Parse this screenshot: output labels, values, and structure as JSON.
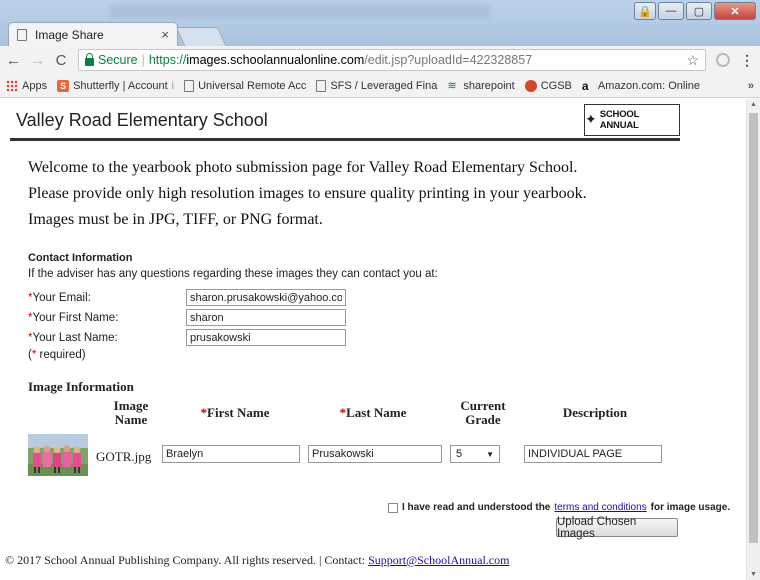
{
  "browser": {
    "tab_title": "Image Share",
    "tab_close": "×",
    "window_buttons": [
      "🔒",
      "—",
      "▢",
      "✕"
    ],
    "nav": {
      "back": "←",
      "forward": "→",
      "reload": "C"
    },
    "omnibox": {
      "secure_label": "Secure",
      "scheme": "https://",
      "host": "images.schoolannualonline.com",
      "path": "/edit.jsp?uploadId=422328857",
      "star": "☆"
    },
    "menu": "⋮",
    "bookmarks": [
      {
        "icon": "apps-icon",
        "label": "Apps",
        "dim": ""
      },
      {
        "icon": "shutterfly-icon",
        "label": "Shutterfly | Account",
        "dim": " i"
      },
      {
        "icon": "page-icon",
        "label": "Universal Remote Acc",
        "dim": ""
      },
      {
        "icon": "page-icon",
        "label": "SFS / Leveraged Fina",
        "dim": ""
      },
      {
        "icon": "sharepoint-icon",
        "label": "sharepoint",
        "dim": ""
      },
      {
        "icon": "cgsb-icon",
        "label": "CGSB",
        "dim": ""
      },
      {
        "icon": "amazon-icon",
        "label": "Amazon.com: Online",
        "dim": ""
      }
    ],
    "bookmarks_more": "»",
    "sharepoint_glyph": "≋",
    "shutterfly_glyph": "S",
    "amazon_glyph": "a"
  },
  "page": {
    "school_name": "Valley Road Elementary School",
    "logo_text": "SCHOOL ANNUAL",
    "logo_mark": "✦",
    "intro_lines": [
      "Welcome to the yearbook photo submission page for Valley Road Elementary School.",
      "Please provide only high resolution images to ensure quality printing in your yearbook.",
      "Images must be in JPG, TIFF, or PNG format."
    ],
    "contact": {
      "title": "Contact Information",
      "note": "If the adviser has any questions regarding these images they can contact you at:",
      "asterisk": "*",
      "fields": [
        {
          "label": "Your Email:",
          "value": "sharon.prusakowski@yahoo.com"
        },
        {
          "label": "Your First Name:",
          "value": "sharon"
        },
        {
          "label": "Your Last Name:",
          "value": "prusakowski"
        }
      ],
      "required_note": "(* required)"
    },
    "image_info": {
      "title": "Image Information",
      "headers": {
        "image_name": [
          "Image",
          "Name"
        ],
        "first_name": "First Name",
        "last_name": "Last Name",
        "grade": [
          "Current",
          "Grade"
        ],
        "description": "Description"
      },
      "row": {
        "filename": "GOTR.jpg",
        "first_name": "Braelyn",
        "last_name": "Prusakowski",
        "grade": "5",
        "description": "INDIVIDUAL PAGE"
      }
    },
    "terms": {
      "prefix": "I have read and understood the",
      "link": "terms and conditions",
      "suffix": "for image usage."
    },
    "upload_button": "Upload Chosen Images",
    "footer": {
      "text": "© 2017 School Annual Publishing Company. All rights reserved. | Contact:",
      "link": "Support@SchoolAnnual.com"
    }
  },
  "colors": {
    "secure_green": "#0b8043",
    "required_red": "#cc0000",
    "link_blue": "#1a0dab"
  }
}
